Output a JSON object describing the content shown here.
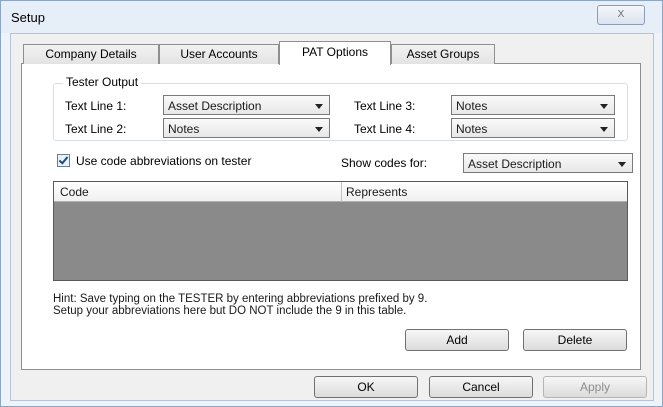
{
  "window": {
    "title": "Setup",
    "close_label": "X"
  },
  "tabs": [
    {
      "label": "Company Details"
    },
    {
      "label": "User Accounts"
    },
    {
      "label": "PAT Options"
    },
    {
      "label": "Asset Groups"
    }
  ],
  "tester_output": {
    "legend": "Tester Output",
    "lines": [
      {
        "label": "Text Line 1:",
        "value": "Asset Description"
      },
      {
        "label": "Text Line 2:",
        "value": "Notes"
      },
      {
        "label": "Text Line 3:",
        "value": "Notes"
      },
      {
        "label": "Text Line 4:",
        "value": "Notes"
      }
    ]
  },
  "abbreviations": {
    "checkbox_label": "Use code abbreviations on tester",
    "checked": true,
    "show_codes_label": "Show codes for:",
    "show_codes_value": "Asset Description"
  },
  "table": {
    "columns": [
      "Code",
      "Represents"
    ],
    "rows": []
  },
  "hint": {
    "line1": "Hint: Save typing on the TESTER by entering abbreviations prefixed by 9.",
    "line2": "Setup your abbreviations here but DO NOT include the 9 in this table."
  },
  "buttons": {
    "add": "Add",
    "delete": "Delete",
    "ok": "OK",
    "cancel": "Cancel",
    "apply": "Apply"
  }
}
